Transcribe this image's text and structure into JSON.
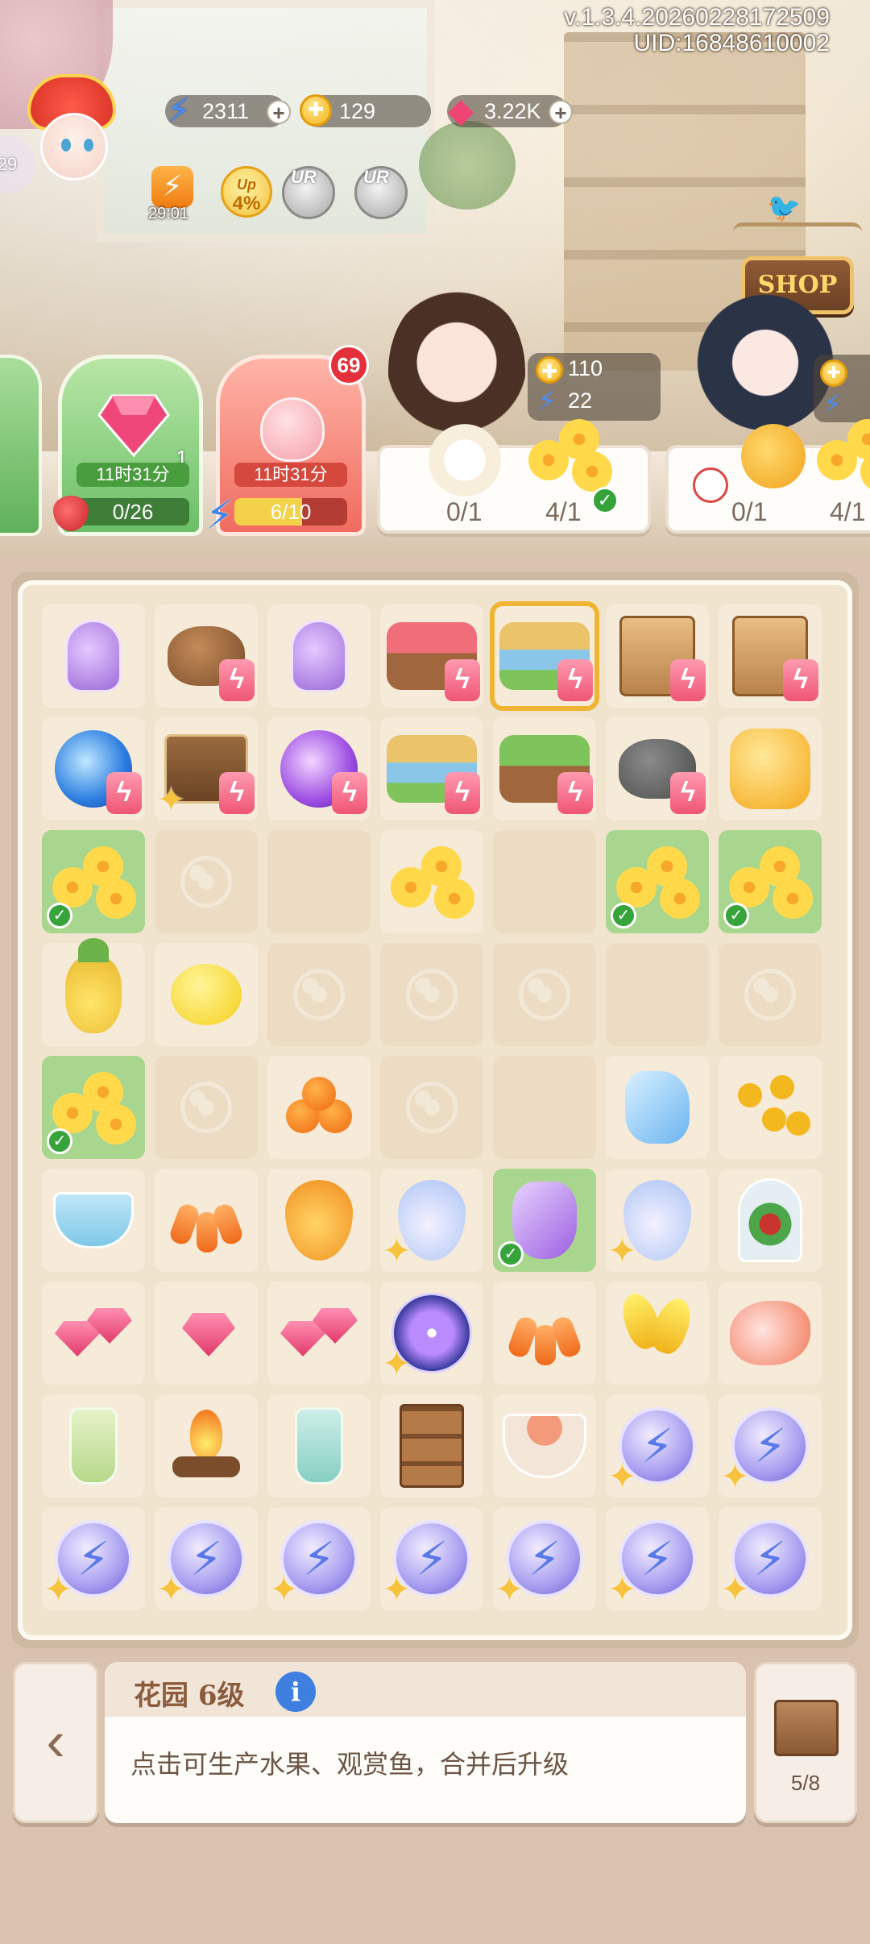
{
  "version": "v.1.3.4.20260228172509",
  "uid": "UID:16848610002",
  "player": {
    "level": "29"
  },
  "resources": {
    "energy": "2311",
    "coins": "129",
    "gems": "3.22K",
    "plus": "+"
  },
  "boosts": {
    "timer": "29:01",
    "up_label": "Up",
    "up_percent": "4%",
    "ur_label": "UR"
  },
  "shop": {
    "label": "SHOP"
  },
  "generators": [
    {
      "name": "gem-generator",
      "count": "1",
      "timer": "11时31分",
      "progress_text": "0/26",
      "progress": 0.0
    },
    {
      "name": "peach-generator",
      "badge": "69",
      "timer": "11时31分",
      "progress_text": "6/10",
      "progress": 0.6
    }
  ],
  "orders": [
    {
      "reward_coins": "110",
      "reward_energy": "22",
      "item1_count": "0/1",
      "item2_count": "4/1"
    },
    {
      "item1_count": "0/1",
      "item2_count": "4/1"
    }
  ],
  "board": {
    "cells": [
      [
        "potion",
        "teapot",
        "potion",
        "garden-flower",
        "garden-water-selected",
        "cabinet",
        "cabinet"
      ],
      [
        "blue-orb",
        "chest",
        "purple-orb",
        "garden-water",
        "garden-plant",
        "gray-teapot",
        "amber"
      ],
      [
        "yellow-flower-done",
        "empty-ghost",
        "empty",
        "yellow-flower",
        "empty",
        "yellow-flower-done",
        "yellow-flower-done"
      ],
      [
        "pineapple",
        "lemon",
        "empty-ghost",
        "empty-ghost",
        "empty-ghost",
        "empty",
        "empty-ghost"
      ],
      [
        "yellow-flower-done",
        "empty-ghost",
        "kumquat",
        "empty-ghost",
        "empty",
        "ice-crystal",
        "flower-branch"
      ],
      [
        "teacup",
        "trumpet-flower",
        "orange-drop",
        "blue-drop",
        "amethyst-done",
        "blue-drop",
        "terrarium"
      ],
      [
        "rubies",
        "ruby",
        "rubies",
        "galaxy-orb",
        "trumpet-flower",
        "yellow-lily",
        "koi"
      ],
      [
        "green-bottle",
        "campfire",
        "teal-bottle",
        "bookshelf",
        "tea-bowl",
        "energy-orb",
        "energy-orb"
      ],
      [
        "energy-orb",
        "energy-orb",
        "energy-orb",
        "energy-orb",
        "energy-orb",
        "energy-orb",
        "energy-orb"
      ]
    ]
  },
  "info": {
    "title": "花园 6级",
    "info_icon": "i",
    "description": "点击可生产水果、观赏鱼，合并后升级"
  },
  "inventory": {
    "label": "5/8"
  },
  "colors": {
    "board_bg": "#f1e4cf",
    "done_cell": "#a8d68e",
    "check_green": "#36a43a",
    "accent_red": "#e3303a"
  }
}
